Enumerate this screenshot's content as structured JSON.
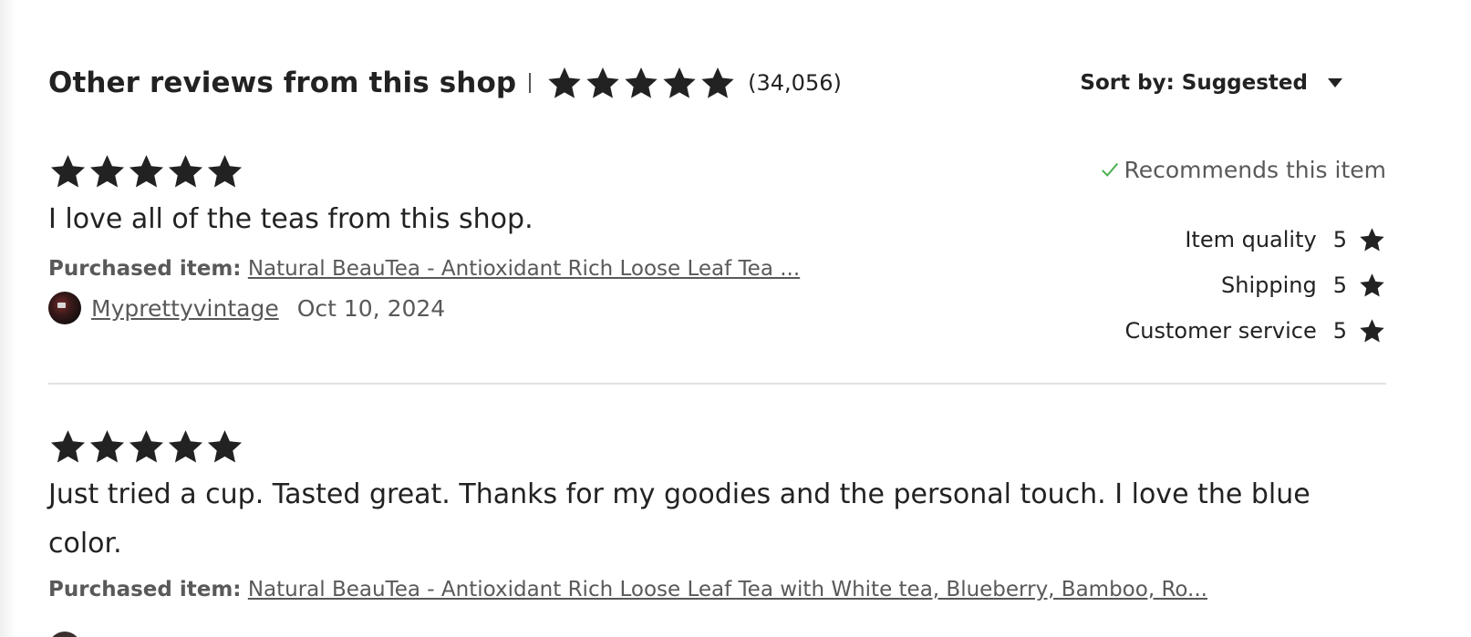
{
  "header": {
    "title": "Other reviews from this shop",
    "rating_stars": 5,
    "review_count": "(34,056)"
  },
  "sort": {
    "label": "Sort by: Suggested",
    "icon": "caret-down-icon"
  },
  "reviews": [
    {
      "stars": 5,
      "text": "I love all of the teas from this shop.",
      "purchased_label": "Purchased item:",
      "purchased_item": "Natural BeauTea - Antioxidant Rich Loose Leaf Tea ...",
      "author": "Myprettyvintage",
      "date": "Oct 10, 2024",
      "recommends": "Recommends this item",
      "ratings": [
        {
          "label": "Item quality",
          "value": "5"
        },
        {
          "label": "Shipping",
          "value": "5"
        },
        {
          "label": "Customer service",
          "value": "5"
        }
      ]
    },
    {
      "stars": 5,
      "text": "Just tried a cup. Tasted great. Thanks for my goodies and the personal touch. I love the blue color.",
      "purchased_label": "Purchased item:",
      "purchased_item": "Natural BeauTea - Antioxidant Rich Loose Leaf Tea with White tea, Blueberry, Bamboo, Ro..."
    }
  ],
  "colors": {
    "text_primary": "#222222",
    "text_secondary": "#595959",
    "check_green": "#4caf50",
    "divider": "#e1e1e1"
  }
}
